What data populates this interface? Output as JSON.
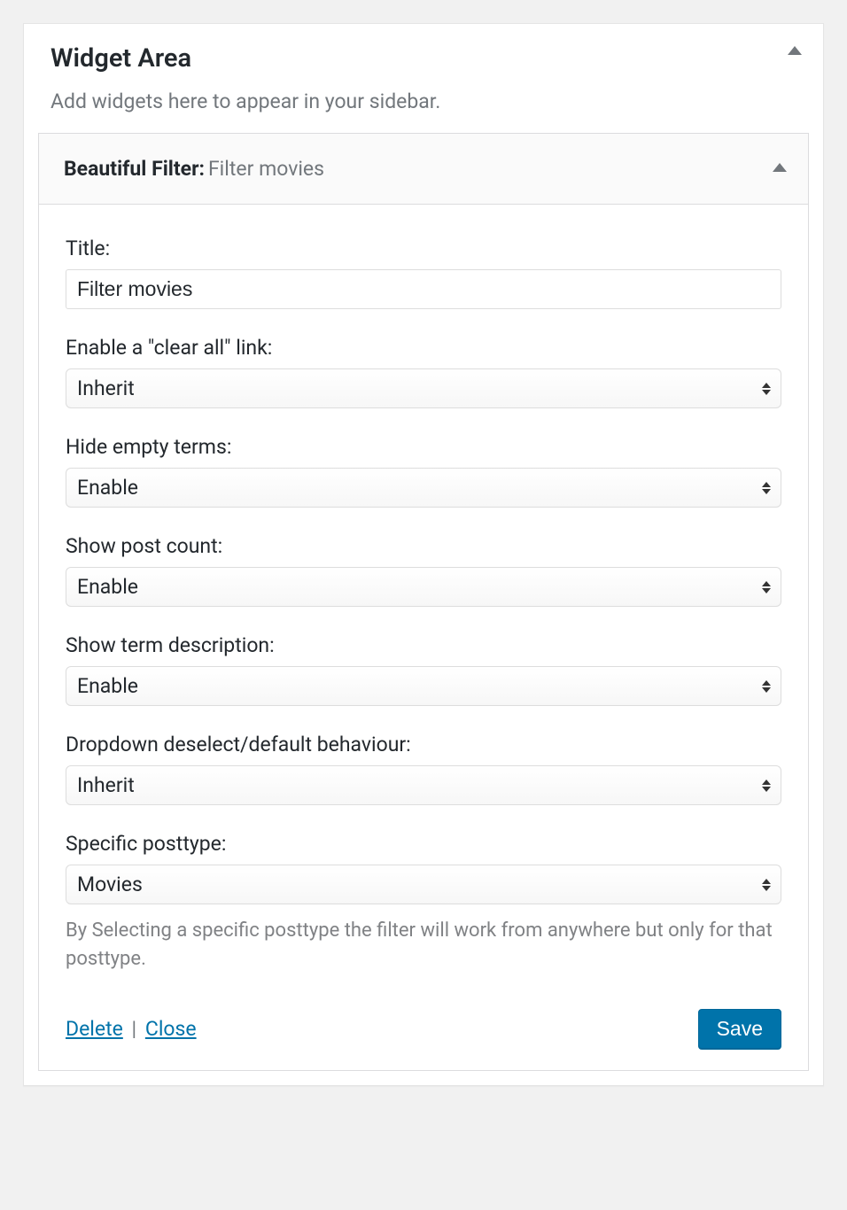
{
  "panel": {
    "title": "Widget Area",
    "description": "Add widgets here to appear in your sidebar."
  },
  "widget": {
    "prefix": "Beautiful Filter:",
    "name": "Filter movies"
  },
  "fields": {
    "title": {
      "label": "Title:",
      "value": "Filter movies"
    },
    "clear_all": {
      "label": "Enable a \"clear all\" link:",
      "value": "Inherit"
    },
    "hide_empty": {
      "label": "Hide empty terms:",
      "value": "Enable"
    },
    "post_count": {
      "label": "Show post count:",
      "value": "Enable"
    },
    "term_desc": {
      "label": "Show term description:",
      "value": "Enable"
    },
    "dropdown_deselect": {
      "label": "Dropdown deselect/default behaviour:",
      "value": "Inherit"
    },
    "posttype": {
      "label": "Specific posttype:",
      "value": "Movies",
      "help": "By Selecting a specific posttype the filter will work from anywhere but only for that posttype."
    }
  },
  "actions": {
    "delete": "Delete",
    "close": "Close",
    "separator": " | ",
    "save": "Save"
  }
}
